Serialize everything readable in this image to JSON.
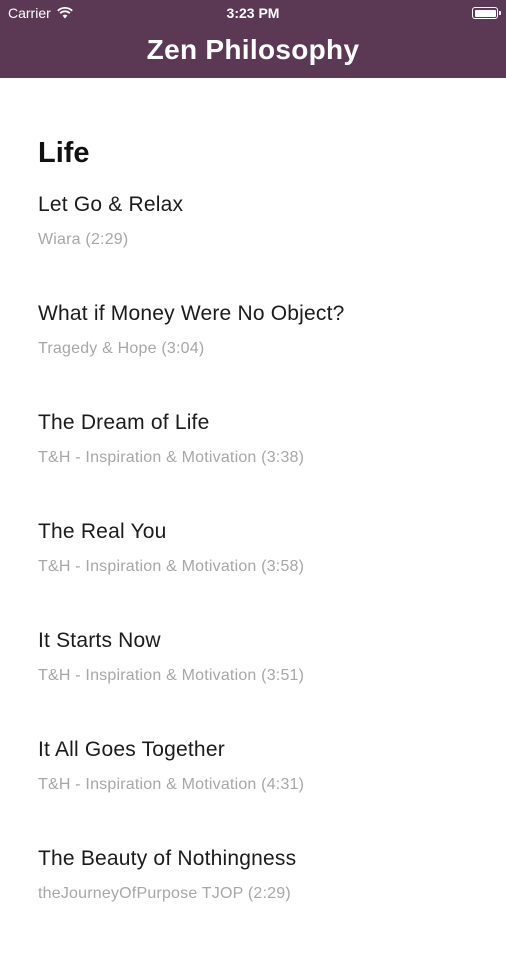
{
  "status_bar": {
    "carrier": "Carrier",
    "time": "3:23 PM",
    "battery_level": 1.0
  },
  "header": {
    "title": "Zen Philosophy",
    "background_color": "#5b3955"
  },
  "section": {
    "title": "Life",
    "items": [
      {
        "title": "Let Go & Relax",
        "subtitle": "Wiara (2:29)"
      },
      {
        "title": "What if Money Were No Object?",
        "subtitle": "Tragedy & Hope (3:04)"
      },
      {
        "title": "The Dream of Life",
        "subtitle": "T&H - Inspiration & Motivation (3:38)"
      },
      {
        "title": "The Real You",
        "subtitle": "T&H - Inspiration & Motivation (3:58)"
      },
      {
        "title": "It Starts Now",
        "subtitle": "T&H - Inspiration & Motivation (3:51)"
      },
      {
        "title": "It All Goes Together",
        "subtitle": "T&H - Inspiration & Motivation (4:31)"
      },
      {
        "title": "The Beauty of Nothingness",
        "subtitle": "theJourneyOfPurpose TJOP (2:29)"
      }
    ]
  }
}
